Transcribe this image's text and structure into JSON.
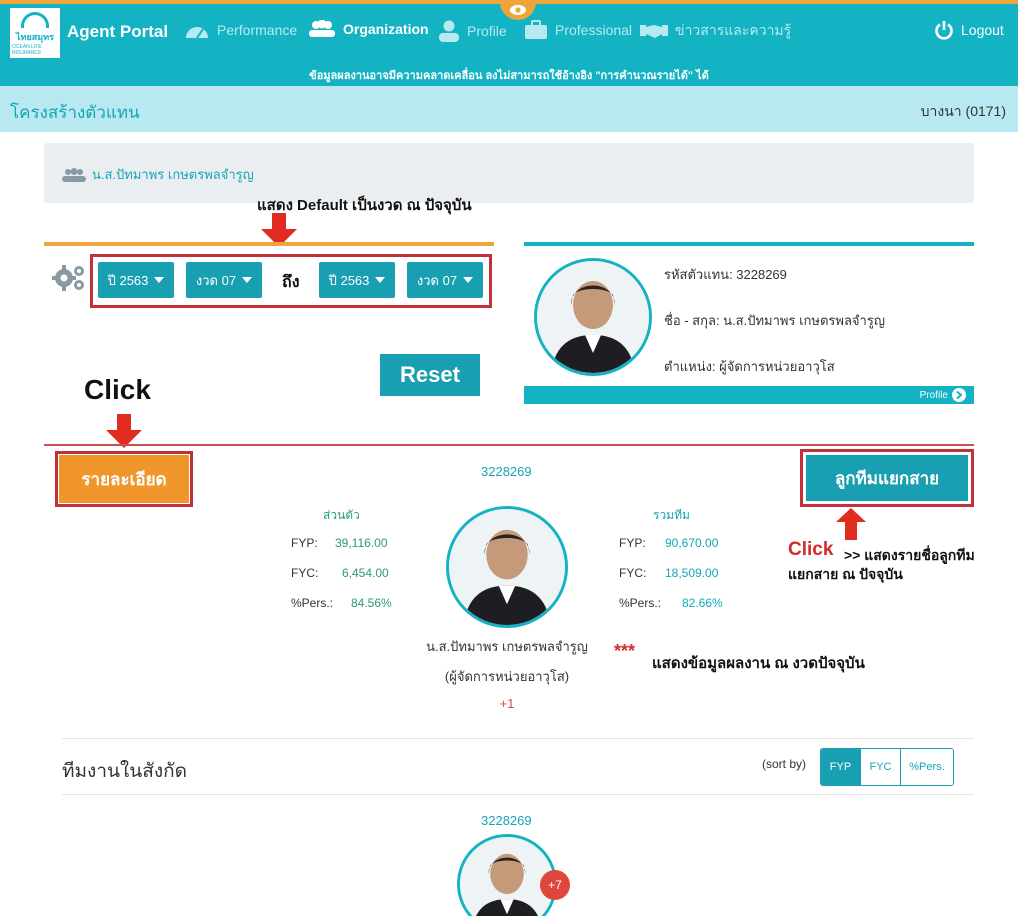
{
  "nav": {
    "brand": "Agent Portal",
    "items": [
      {
        "label": "Performance",
        "icon": "gauge-icon"
      },
      {
        "label": "Organization",
        "icon": "users-icon"
      },
      {
        "label": "Profile",
        "icon": "user-icon"
      },
      {
        "label": "Professional",
        "icon": "briefcase-icon"
      },
      {
        "label": "ข่าวสารและความรู้",
        "icon": "handshake-icon"
      }
    ],
    "logout": "Logout",
    "marquee": "ข้อมูลผลงานอาจมีความคลาดเคลื่อน ลงไม่สามารถใช้อ้างอิง \"การคำนวณรายได้\" ได้",
    "logo_text": "ไทยสมุทร",
    "logo_sub": "OCEAN LIFE INSURANCE"
  },
  "page": {
    "title": "โครงสร้างตัวแทน",
    "branch": "บางนา (0171)"
  },
  "breadcrumb": {
    "name": "น.ส.ปัทมาพร เกษตรพลจำรูญ"
  },
  "annotations": {
    "default_note": "แสดง Default เป็นงวด ณ ปัจจุบัน",
    "click_left": "Click",
    "click_right": "Click",
    "click_right_note_1": ">> แสดงรายชื่อลูกทีม",
    "click_right_note_2": "แยกสาย ณ ปัจจุบัน",
    "stars": "***",
    "perf_note": "แสดงข้อมูลผลงาน ณ งวดปัจจุบัน"
  },
  "filter": {
    "from_year": "ปี 2563",
    "from_period": "งวด 07",
    "to_label": "ถึง",
    "to_year": "ปี 2563",
    "to_period": "งวด 07",
    "reset": "Reset"
  },
  "profile_card": {
    "code_line": "รหัสตัวแทน: 3228269",
    "name_line": "ชื่อ - สกุล: น.ส.ปัทมาพร เกษตรพลจำรูญ",
    "position_line": "ตำแหน่ง: ผู้จัดการหน่วยอาวุโส",
    "footer_link": "Profile"
  },
  "buttons": {
    "detail": "รายละเอียด",
    "split_team": "ลูกทีมแยกสาย"
  },
  "summary": {
    "agent_code": "3228269",
    "personal_heading": "ส่วนตัว",
    "team_heading": "รวมทีม",
    "personal": [
      {
        "label": "FYP:",
        "value": "39,116.00"
      },
      {
        "label": "FYC:",
        "value": "6,454.00"
      },
      {
        "label": "%Pers.:",
        "value": "84.56%"
      }
    ],
    "team": [
      {
        "label": "FYP:",
        "value": "90,670.00"
      },
      {
        "label": "FYC:",
        "value": "18,509.00"
      },
      {
        "label": "%Pers.:",
        "value": "82.66%"
      }
    ],
    "name": "น.ส.ปัทมาพร เกษตรพลจำรูญ",
    "position": "(ผู้จัดการหน่วยอาวุโส)",
    "extra": "+1"
  },
  "team_section": {
    "title": "ทีมงานในสังกัด",
    "sort_by": "(sort by)",
    "sort_options": [
      "FYP",
      "FYC",
      "%Pers."
    ],
    "member_code": "3228269",
    "member_badge": "+7"
  }
}
